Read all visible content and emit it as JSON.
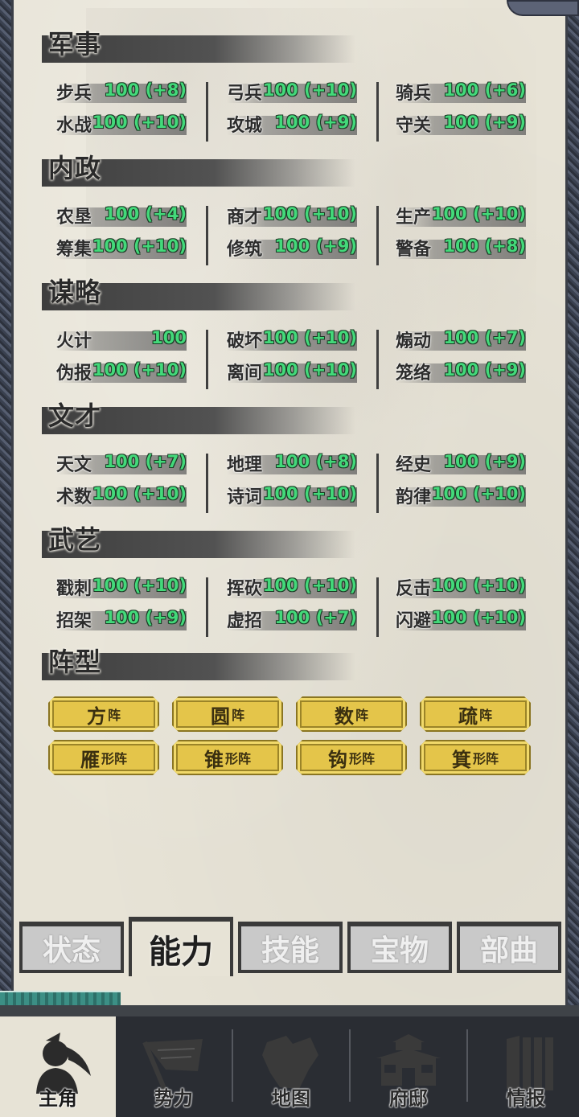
{
  "sections": [
    {
      "title": "军事",
      "stats": [
        {
          "name": "步兵",
          "value": "100 (+8)"
        },
        {
          "name": "水战",
          "value": "100 (+10)"
        },
        {
          "name": "弓兵",
          "value": "100 (+10)"
        },
        {
          "name": "攻城",
          "value": "100 (+9)"
        },
        {
          "name": "骑兵",
          "value": "100 (+6)"
        },
        {
          "name": "守关",
          "value": "100 (+9)"
        }
      ]
    },
    {
      "title": "内政",
      "stats": [
        {
          "name": "农垦",
          "value": "100 (+4)"
        },
        {
          "name": "筹集",
          "value": "100 (+10)"
        },
        {
          "name": "商才",
          "value": "100 (+10)"
        },
        {
          "name": "修筑",
          "value": "100 (+9)"
        },
        {
          "name": "生产",
          "value": "100 (+10)"
        },
        {
          "name": "警备",
          "value": "100 (+8)"
        }
      ]
    },
    {
      "title": "谋略",
      "stats": [
        {
          "name": "火计",
          "value": "100"
        },
        {
          "name": "伪报",
          "value": "100 (+10)"
        },
        {
          "name": "破坏",
          "value": "100 (+10)"
        },
        {
          "name": "离间",
          "value": "100 (+10)"
        },
        {
          "name": "煽动",
          "value": "100 (+7)"
        },
        {
          "name": "笼络",
          "value": "100 (+9)"
        }
      ]
    },
    {
      "title": "文才",
      "stats": [
        {
          "name": "天文",
          "value": "100 (+7)"
        },
        {
          "name": "术数",
          "value": "100 (+10)"
        },
        {
          "name": "地理",
          "value": "100 (+8)"
        },
        {
          "name": "诗词",
          "value": "100 (+10)"
        },
        {
          "name": "经史",
          "value": "100 (+9)"
        },
        {
          "name": "韵律",
          "value": "100 (+10)"
        }
      ]
    },
    {
      "title": "武艺",
      "stats": [
        {
          "name": "戳刺",
          "value": "100 (+10)"
        },
        {
          "name": "招架",
          "value": "100 (+9)"
        },
        {
          "name": "挥砍",
          "value": "100 (+10)"
        },
        {
          "name": "虚招",
          "value": "100 (+7)"
        },
        {
          "name": "反击",
          "value": "100 (+10)"
        },
        {
          "name": "闪避",
          "value": "100 (+10)"
        }
      ]
    }
  ],
  "formation": {
    "title": "阵型",
    "buttons": [
      {
        "main": "方",
        "suffix": "阵"
      },
      {
        "main": "圆",
        "suffix": "阵"
      },
      {
        "main": "数",
        "suffix": "阵"
      },
      {
        "main": "疏",
        "suffix": "阵"
      },
      {
        "main": "雁",
        "suffix": "形阵"
      },
      {
        "main": "锥",
        "suffix": "形阵"
      },
      {
        "main": "钩",
        "suffix": "形阵"
      },
      {
        "main": "箕",
        "suffix": "形阵"
      }
    ]
  },
  "tabs": [
    {
      "label": "状态",
      "active": false
    },
    {
      "label": "能力",
      "active": true
    },
    {
      "label": "技能",
      "active": false
    },
    {
      "label": "宝物",
      "active": false
    },
    {
      "label": "部曲",
      "active": false
    }
  ],
  "bottom_nav": [
    {
      "label": "主角",
      "icon": "warrior-icon",
      "active": true
    },
    {
      "label": "势力",
      "icon": "flag-icon",
      "active": false
    },
    {
      "label": "地图",
      "icon": "map-icon",
      "active": false
    },
    {
      "label": "府邸",
      "icon": "mansion-icon",
      "active": false
    },
    {
      "label": "情报",
      "icon": "scroll-icon",
      "active": false
    }
  ],
  "colors": {
    "paper": "#e7e3d6",
    "stat_value": "#43d97a",
    "formation_button": "#e4c54a",
    "frame": "#2b2e36"
  }
}
